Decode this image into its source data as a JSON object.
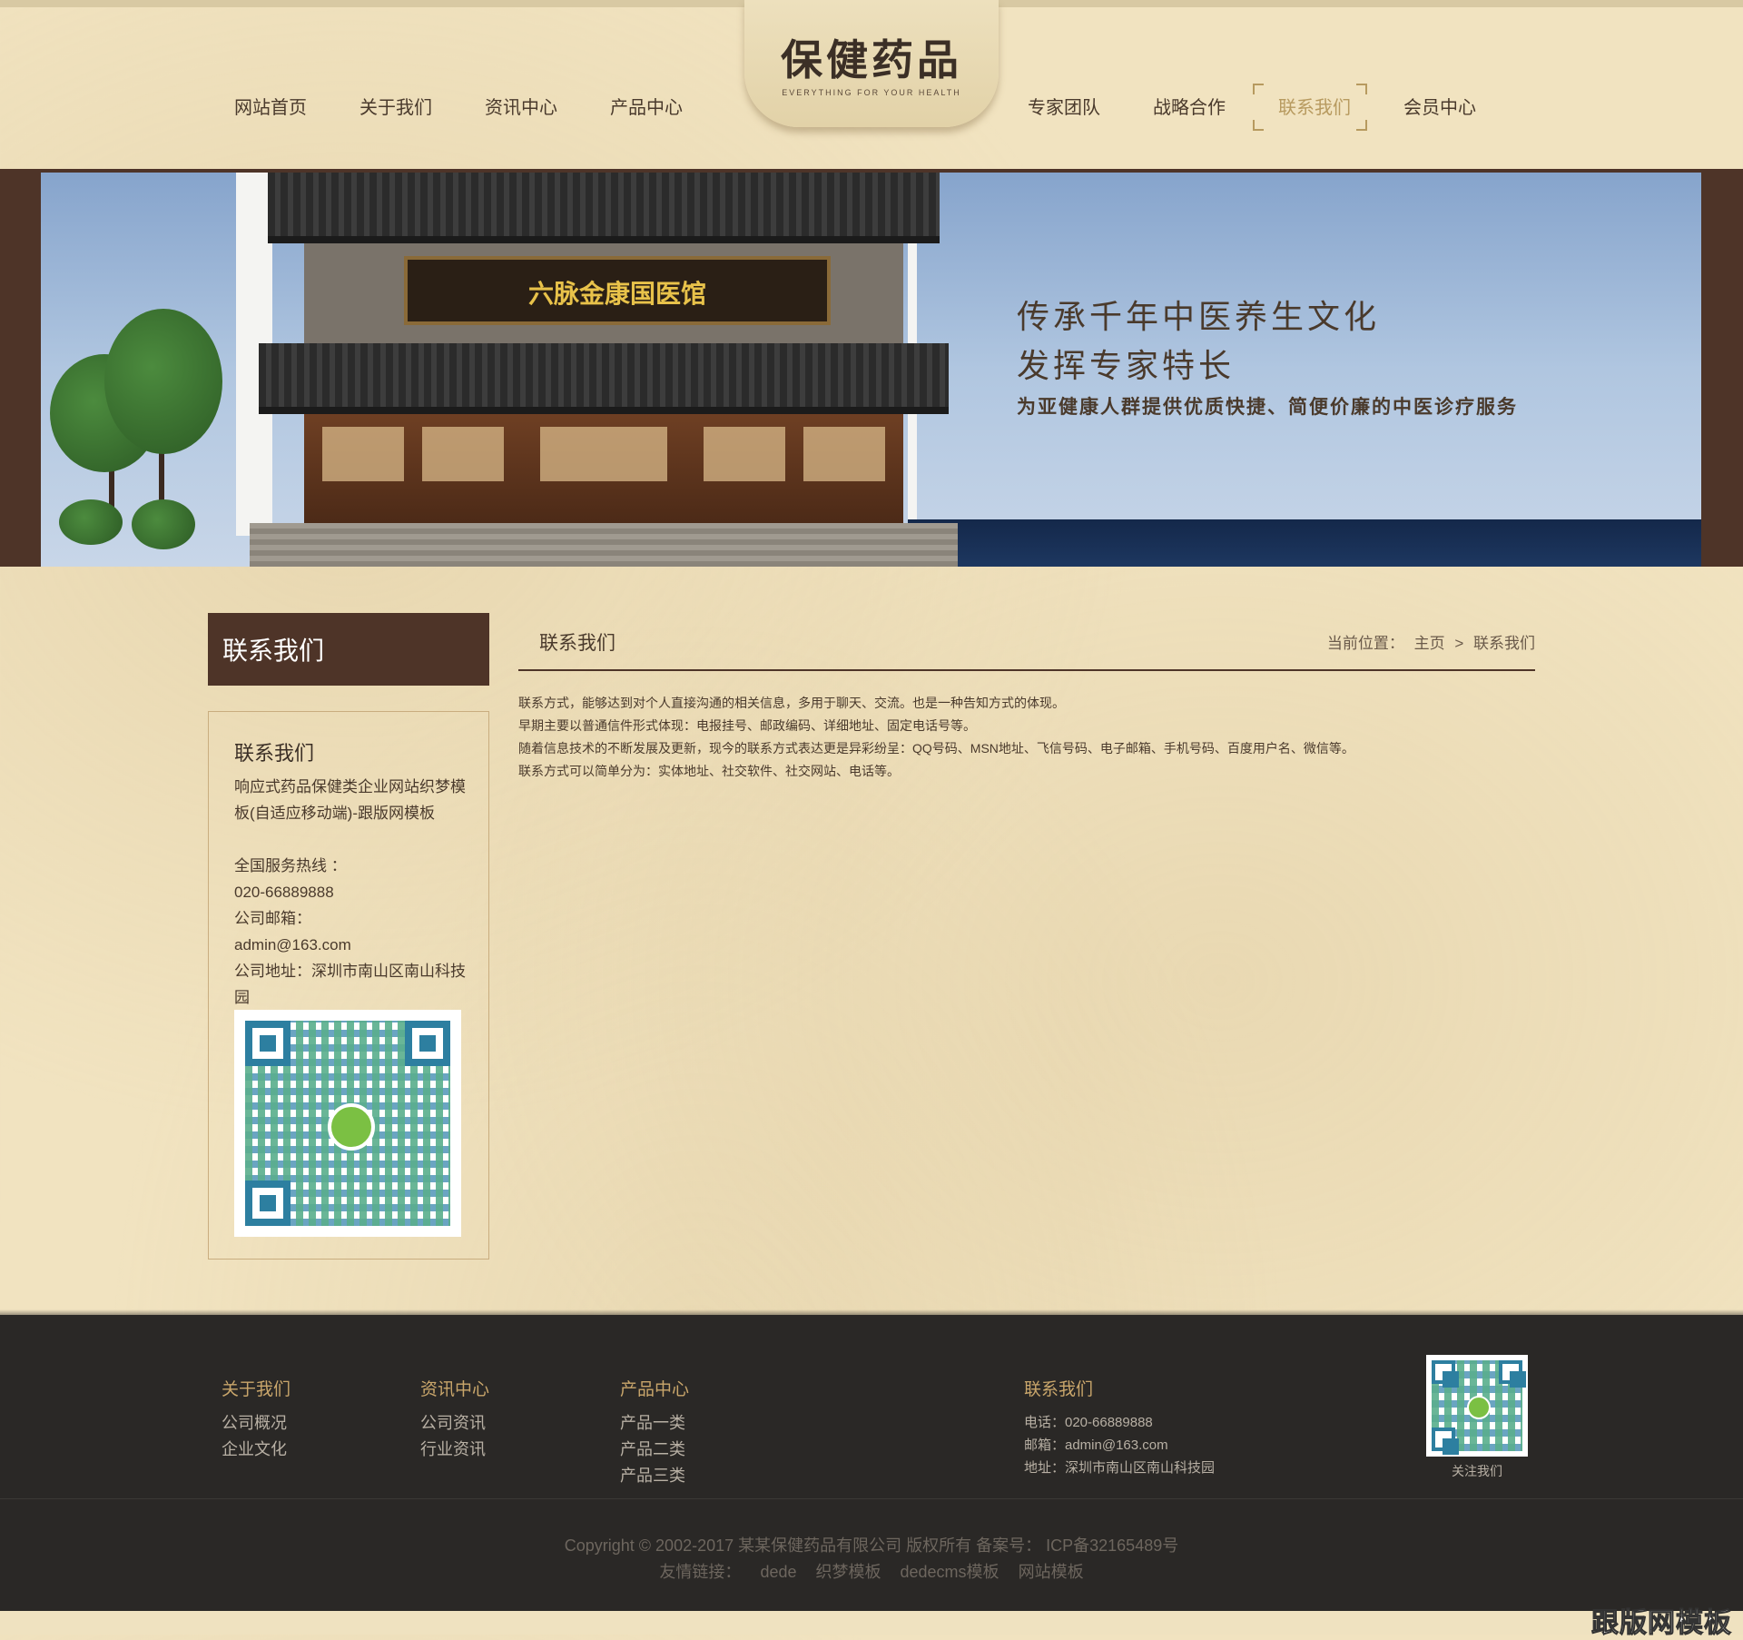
{
  "nav": {
    "left": [
      "网站首页",
      "关于我们",
      "资讯中心",
      "产品中心"
    ],
    "right": [
      "专家团队",
      "战略合作",
      "联系我们",
      "会员中心"
    ],
    "active": "联系我们"
  },
  "logo": {
    "title": "保健药品",
    "subtitle": "EVERYTHING FOR YOUR HEALTH"
  },
  "banner": {
    "sign": "六脉金康国医馆",
    "line1": "传承千年中医养生文化",
    "line2": "发挥专家特长",
    "line3": "为亚健康人群提供优质快捷、简便价廉的中医诊疗服务"
  },
  "sidebar": {
    "heading": "联系我们",
    "box_title": "联系我们",
    "company": "响应式药品保健类企业网站织梦模板(自适应移动端)-跟版网模板",
    "hotline_label": "全国服务热线 ：",
    "hotline": " 020-66889888",
    "email_label": "公司邮箱：",
    "email": " admin@163.com",
    "address": "公司地址：深圳市南山区南山科技园"
  },
  "main": {
    "title": "联系我们",
    "breadcrumb_label": "当前位置：",
    "breadcrumb_home": "主页",
    "breadcrumb_sep": ">",
    "breadcrumb_current": "联系我们",
    "paragraphs": [
      " 联系方式，能够达到对个人直接沟通的相关信息，多用于聊天、交流。也是一种告知方式的体现。",
      "早期主要以普通信件形式体现：电报挂号、邮政编码、详细地址、固定电话号等。",
      "随着信息技术的不断发展及更新，现今的联系方式表达更是异彩纷呈：QQ号码、MSN地址、飞信号码、电子邮箱、手机号码、百度用户名、微信等。",
      "联系方式可以简单分为：实体地址、社交软件、社交网站、电话等。"
    ]
  },
  "footer": {
    "col1": {
      "title": "关于我们",
      "links": [
        "公司概况",
        "企业文化"
      ]
    },
    "col2": {
      "title": "资讯中心",
      "links": [
        "公司资讯",
        "行业资讯"
      ]
    },
    "col3": {
      "title": "产品中心",
      "links": [
        "产品一类",
        "产品二类",
        "产品三类"
      ]
    },
    "contact": {
      "title": "联系我们",
      "phone": "电话：020-66889888",
      "email": "邮箱：admin@163.com",
      "address": "地址：深圳市南山区南山科技园"
    },
    "follow": "关注我们",
    "copyright": "Copyright © 2002-2017 某某保健药品有限公司 版权所有 备案号： ICP备32165489号",
    "friends_label": "友情链接：",
    "friends": [
      "dede",
      "织梦模板",
      "dedecms模板",
      "网站模板"
    ]
  },
  "watermark": "跟版网模板",
  "colors": {
    "brown": "#4e3428",
    "gold": "#c9a66b",
    "paper": "#f1e3c0",
    "footer": "#2a2826"
  }
}
